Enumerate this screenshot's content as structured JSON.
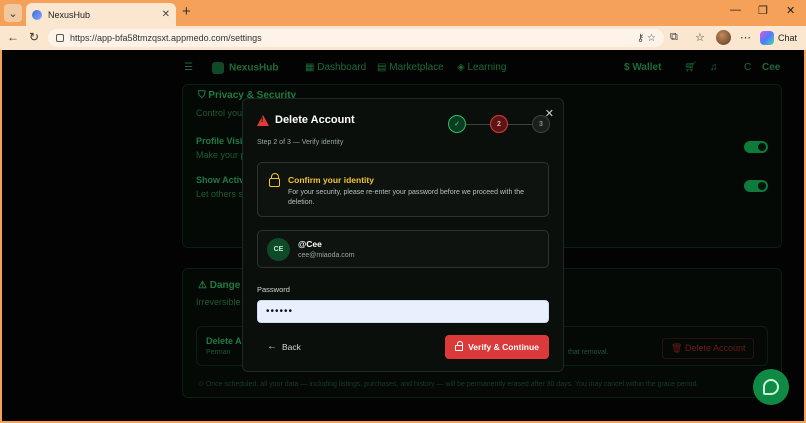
{
  "browser": {
    "tab_title": "NexusHub",
    "url": "https://app-bfa58tmzqsxt.appmedo.com/settings",
    "chat_label": "Chat"
  },
  "app_nav": {
    "brand": "NexusHub",
    "items": [
      "Dashboard",
      "Marketplace",
      "Learning"
    ],
    "wallet": "Wallet",
    "user_initial": "C",
    "user_name": "Cee"
  },
  "background": {
    "privacy_title": "Privacy & Security",
    "privacy_desc": "Control your",
    "profile_vis_label": "Profile Visibi",
    "profile_vis_desc": "Make your p",
    "show_activity_label": "Show Activit",
    "show_activity_desc": "Let others se",
    "danger_title": "Dange",
    "danger_desc": "Irreversible a",
    "delete_label": "Delete Ac",
    "delete_desc": "Perman",
    "delete_desc_tail": "that removal.",
    "delete_button": "Delete Account",
    "footer_note": "Once scheduled, all your data — including listings, purchases, and history — will be permanently erased after 30 days. You may cancel within the grace period."
  },
  "modal": {
    "title": "Delete Account",
    "subtitle": "Step 2 of 3 — Verify identity",
    "steps": [
      {
        "label": "✓",
        "state": "done"
      },
      {
        "label": "2",
        "state": "active"
      },
      {
        "label": "3",
        "state": "todo"
      }
    ],
    "confirm_title": "Confirm your identity",
    "confirm_desc": "For your security, please re-enter your password before we proceed with the deletion.",
    "user_initials": "CE",
    "user_handle": "@Cee",
    "user_email": "cee@miaoda.com",
    "password_label": "Password",
    "password_value": "••••••",
    "back_label": "Back",
    "verify_label": "Verify & Continue"
  },
  "colors": {
    "accent_green": "#22c55e",
    "danger_red": "#dc3a3a",
    "warning_yellow": "#f4c430"
  }
}
